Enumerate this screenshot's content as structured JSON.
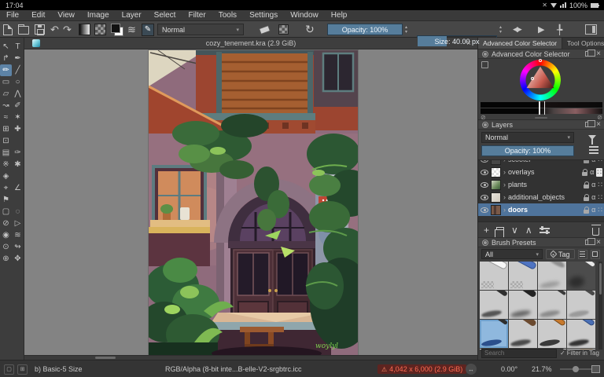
{
  "status_bar": {
    "time": "17:04",
    "battery": "100%"
  },
  "menu": {
    "items": [
      "File",
      "Edit",
      "View",
      "Image",
      "Layer",
      "Select",
      "Filter",
      "Tools",
      "Settings",
      "Window",
      "Help"
    ]
  },
  "toolbar": {
    "blend_mode": "Normal",
    "opacity": "Opacity: 100%",
    "size": "Size: 40.00 px"
  },
  "document": {
    "tab_title": "cozy_tenement.kra (2.9 GiB)"
  },
  "icons": {
    "close": "×",
    "warning": "⚠",
    "check": "✓",
    "dropdown": "▾",
    "spin_up": "▴",
    "spin_down": "▾",
    "undo": "↶",
    "redo": "↷",
    "reload": "↻",
    "wrap": "≋",
    "brush_edit": "✎",
    "mirror": "◀▶",
    "snap": "▶",
    "crop_overlay": "╄",
    "circle_slash": "⊘",
    "resize_arrow": "↔",
    "plus": "+",
    "arrow_down": "∨",
    "arrow_up": "∧",
    "mute": "✕",
    "chevron": "›",
    "alpha": "α",
    "layer_props": "∷"
  },
  "toolbox": {
    "tools": [
      {
        "glyph": "↖",
        "name": "select-shapes"
      },
      {
        "glyph": "T",
        "name": "text"
      },
      {
        "glyph": "↱",
        "name": "edit-shapes"
      },
      {
        "glyph": "✒",
        "name": "calligraphy"
      },
      {
        "glyph": "✏",
        "name": "freehand-brush",
        "selected": true
      },
      {
        "glyph": "╱",
        "name": "line"
      },
      {
        "glyph": "▭",
        "name": "rectangle"
      },
      {
        "glyph": "○",
        "name": "ellipse"
      },
      {
        "glyph": "▱",
        "name": "polygon"
      },
      {
        "glyph": "⋀",
        "name": "polyline"
      },
      {
        "glyph": "↝",
        "name": "bezier-curve"
      },
      {
        "glyph": "✐",
        "name": "freehand-path"
      },
      {
        "glyph": "≈",
        "name": "dynamic-brush"
      },
      {
        "glyph": "✶",
        "name": "multibrush"
      },
      {
        "glyph": "⊞",
        "name": "transform"
      },
      {
        "glyph": "✚",
        "name": "move"
      },
      {
        "glyph": "⊡",
        "name": "crop"
      },
      {
        "glyph": "",
        "name": ""
      },
      {
        "glyph": "▤",
        "name": "gradient"
      },
      {
        "glyph": "✑",
        "name": "color-sampler"
      },
      {
        "glyph": "※",
        "name": "pattern-edit"
      },
      {
        "glyph": "✱",
        "name": "smart-patch"
      },
      {
        "glyph": "◈",
        "name": "fill"
      },
      {
        "glyph": "",
        "name": ""
      },
      {
        "glyph": "⌖",
        "name": "assistants"
      },
      {
        "glyph": "∠",
        "name": "measure"
      },
      {
        "glyph": "⚑",
        "name": "reference-images"
      },
      {
        "glyph": "",
        "name": ""
      },
      {
        "glyph": "▢",
        "name": "rectangular-selection"
      },
      {
        "glyph": "◌",
        "name": "elliptical-selection"
      },
      {
        "glyph": "⊘",
        "name": "freehand-selection"
      },
      {
        "glyph": "▷",
        "name": "polygonal-selection"
      },
      {
        "glyph": "◉",
        "name": "magnetic-selection"
      },
      {
        "glyph": "≋",
        "name": "similar-color-selection"
      },
      {
        "glyph": "⊙",
        "name": "contiguous-selection"
      },
      {
        "glyph": "↬",
        "name": "bezier-selection"
      },
      {
        "glyph": "⊕",
        "name": "zoom"
      },
      {
        "glyph": "✥",
        "name": "pan"
      }
    ]
  },
  "panels": {
    "tabs": {
      "color_selector": "Advanced Color Selector",
      "tool_options": "Tool Options"
    },
    "color_selector": {
      "title": "Advanced Color Selector"
    },
    "layers": {
      "title": "Layers",
      "blend_mode": "Normal",
      "opacity": "Opacity: 100%",
      "rows": [
        {
          "name": "scooter"
        },
        {
          "name": "overlays"
        },
        {
          "name": "plants"
        },
        {
          "name": "additional_objects"
        },
        {
          "name": "doors",
          "selected": true
        }
      ]
    },
    "brush_presets": {
      "title": "Brush Presets",
      "tag_filter": "All",
      "tag_button": "Tag",
      "search_placeholder": "Search",
      "filter_in_tag": "Filter in Tag"
    }
  },
  "footer": {
    "brush": "b) Basic-5 Size",
    "profile": "RGB/Alpha (8-bit inte...B-elle-V2-srgbtrc.icc",
    "dimensions": "4,042 x 6,000 (2.9 GiB)",
    "angle": "0.00°",
    "zoom": "21.7%"
  },
  "colors": {
    "accent_blue": "#567d9b",
    "selection_blue": "#4f749c",
    "canvas_gray": "#838383",
    "warning_red": "#ff6b52"
  }
}
